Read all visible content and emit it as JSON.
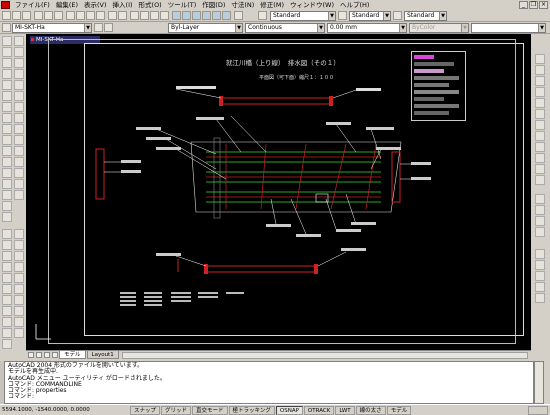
{
  "menu": {
    "items": [
      "ファイル(F)",
      "編集(E)",
      "表示(V)",
      "挿入(I)",
      "形式(O)",
      "ツール(T)",
      "作図(D)",
      "寸法(N)",
      "修正(M)",
      "ウィンドウ(W)",
      "ヘルプ(H)"
    ]
  },
  "toolbar": {
    "text_style": "Standard",
    "dim_style": "Standard",
    "table_style": "Standard",
    "layer": "Byl-Layer",
    "linetype": "Continuous",
    "lineweight": "0.00 mm",
    "plotstyle": "ByColor",
    "workspace": "",
    "drawing_combo": "MI-SKT-Ha"
  },
  "drawing": {
    "doc_tab": "MI-SKT-Ha",
    "title": "就江川橋（上り線）　排水図（その１）",
    "subtitle": "平面図（可下面）縮尺１：１００"
  },
  "layout_tabs": [
    "モデル",
    "Layout1"
  ],
  "command": {
    "lines": [
      "AutoCAD 2004 形式のファイルを開いています。",
      "モデルを再生成中.",
      "AutoCAD メニュー ユーティリティ がロードされました。",
      "コマンド: COMMANDLINE",
      "コマンド: properties",
      "コマンド:"
    ]
  },
  "status": {
    "coords": "5594.1000, -1540.0000, 0.0000",
    "buttons": [
      {
        "label": "スナップ",
        "on": false
      },
      {
        "label": "グリッド",
        "on": false
      },
      {
        "label": "直交モード",
        "on": false
      },
      {
        "label": "極トラッキング",
        "on": false
      },
      {
        "label": "OSNAP",
        "on": true
      },
      {
        "label": "OTRACK",
        "on": false
      },
      {
        "label": "LWT",
        "on": false
      },
      {
        "label": "線の太さ",
        "on": false
      },
      {
        "label": "モデル",
        "on": false
      }
    ]
  }
}
